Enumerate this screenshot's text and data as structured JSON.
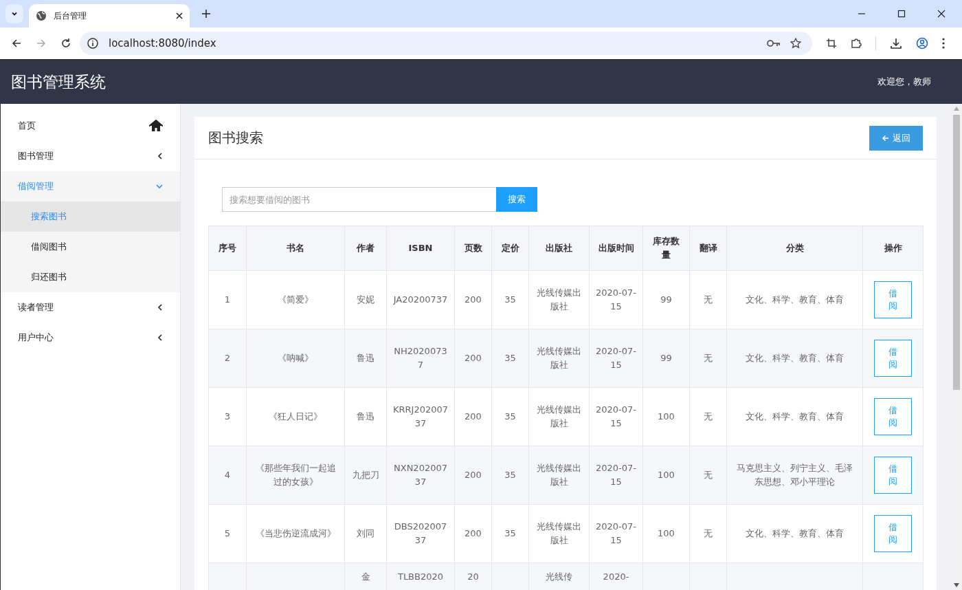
{
  "browser": {
    "tab_title": "后台管理",
    "url": "localhost:8080/index"
  },
  "app": {
    "title": "图书管理系统",
    "welcome": "欢迎您，教师"
  },
  "sidebar": {
    "items": [
      {
        "label": "首页",
        "kind": "home",
        "selected": false
      },
      {
        "label": "图书管理",
        "kind": "group",
        "selected": false,
        "expanded": false
      },
      {
        "label": "借阅管理",
        "kind": "group",
        "selected": true,
        "expanded": true,
        "children": [
          {
            "label": "搜索图书",
            "selected": true
          },
          {
            "label": "借阅图书",
            "selected": false
          },
          {
            "label": "归还图书",
            "selected": false
          }
        ]
      },
      {
        "label": "读者管理",
        "kind": "group",
        "selected": false,
        "expanded": false
      },
      {
        "label": "用户中心",
        "kind": "group",
        "selected": false,
        "expanded": false
      }
    ]
  },
  "card": {
    "title": "图书搜索",
    "back_button": "返回",
    "search": {
      "placeholder": "搜索想要借阅的图书",
      "button": "搜索"
    }
  },
  "table": {
    "columns": [
      "序号",
      "书名",
      "作者",
      "ISBN",
      "页数",
      "定价",
      "出版社",
      "出版时间",
      "库存数量",
      "翻译",
      "分类",
      "操作"
    ],
    "rows": [
      {
        "cells": [
          "1",
          "《简爱》",
          "安妮",
          "JA20200737",
          "200",
          "35",
          "光线传媒出版社",
          "2020-07-15",
          "99",
          "无",
          "文化、科学、教育、体育"
        ],
        "action": "借阅"
      },
      {
        "cells": [
          "2",
          "《呐喊》",
          "鲁迅",
          "NH20200737",
          "200",
          "35",
          "光线传媒出版社",
          "2020-07-15",
          "99",
          "无",
          "文化、科学、教育、体育"
        ],
        "action": "借阅"
      },
      {
        "cells": [
          "3",
          "《狂人日记》",
          "鲁迅",
          "KRRJ20200737",
          "200",
          "35",
          "光线传媒出版社",
          "2020-07-15",
          "100",
          "无",
          "文化、科学、教育、体育"
        ],
        "action": "借阅"
      },
      {
        "cells": [
          "4",
          "《那些年我们一起追过的女孩》",
          "九把刀",
          "NXN20200737",
          "200",
          "35",
          "光线传媒出版社",
          "2020-07-15",
          "100",
          "无",
          "马克思主义、列宁主义、毛泽东思想、邓小平理论"
        ],
        "action": "借阅"
      },
      {
        "cells": [
          "5",
          "《当悲伤逆流成河》",
          "刘同",
          "DBS20200737",
          "200",
          "35",
          "光线传媒出版社",
          "2020-07-15",
          "100",
          "无",
          "文化、科学、教育、体育"
        ],
        "action": "借阅"
      },
      {
        "cells": [
          "",
          "",
          "金",
          "TLBB2020",
          "20",
          "",
          "光线传",
          "2020-",
          "",
          "",
          ""
        ]
      }
    ]
  }
}
